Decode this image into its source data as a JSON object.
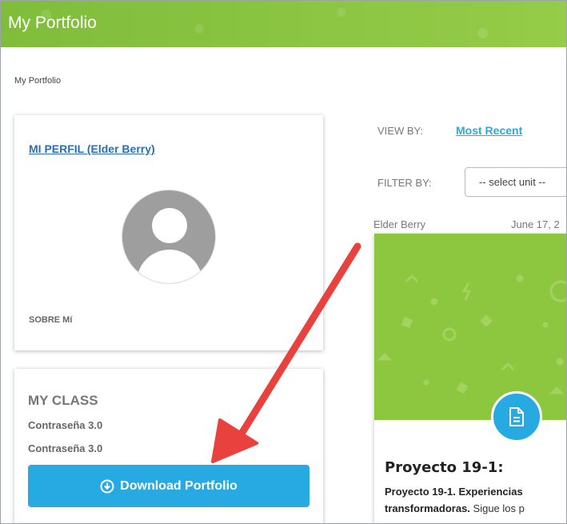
{
  "header": {
    "title": "My Portfolio"
  },
  "breadcrumb": "My Portfolio",
  "profile": {
    "link_label": "MI PERFIL (Elder Berry)",
    "about_label": "SOBRE Mí"
  },
  "my_class": {
    "title": "MY CLASS",
    "line1": "Contraseña 3.0",
    "line2": "Contraseña 3.0",
    "download_label": "Download Portfolio"
  },
  "view_by": {
    "label": "VIEW BY:",
    "value": "Most Recent"
  },
  "filter_by": {
    "label": "FILTER BY:",
    "value": "-- select unit --"
  },
  "post": {
    "author": "Elder Berry",
    "date": "June 17, 2",
    "title": "Proyecto 19-1:",
    "excerpt_bold": "Proyecto 19-1. Experiencias transformadoras.",
    "excerpt_rest": " Sigue los p"
  },
  "colors": {
    "header_green": "#8dc63f",
    "accent_blue": "#27a9e1",
    "link_blue": "#2a6fb5",
    "arrow_red": "#e8413e"
  },
  "icons": [
    "download-circle-icon",
    "document-icon",
    "user-avatar-icon",
    "annotation-arrow"
  ]
}
